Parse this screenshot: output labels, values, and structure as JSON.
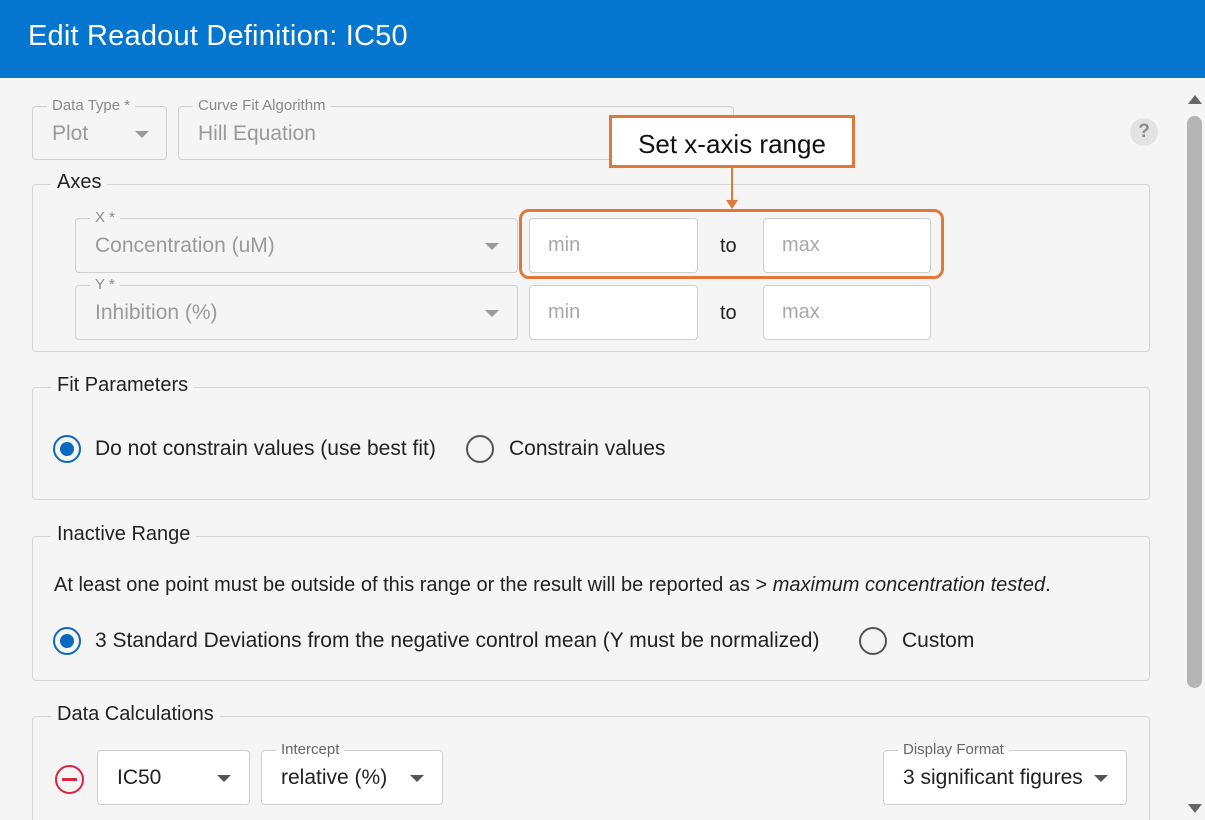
{
  "header": {
    "title": "Edit Readout Definition: IC50"
  },
  "top_fields": {
    "data_type": {
      "label": "Data Type *",
      "value": "Plot"
    },
    "curve_fit": {
      "label": "Curve Fit Algorithm",
      "value": "Hill Equation"
    }
  },
  "help_icon": {
    "glyph": "?"
  },
  "axes": {
    "legend": "Axes",
    "x": {
      "label": "X *",
      "value": "Concentration (uM)",
      "min_placeholder": "min",
      "max_placeholder": "max",
      "to": "to"
    },
    "y": {
      "label": "Y *",
      "value": "Inhibition (%)",
      "min_placeholder": "min",
      "max_placeholder": "max",
      "to": "to"
    }
  },
  "fit_parameters": {
    "legend": "Fit Parameters",
    "options": [
      {
        "label": "Do not constrain values (use best fit)",
        "checked": true
      },
      {
        "label": "Constrain values",
        "checked": false
      }
    ]
  },
  "inactive_range": {
    "legend": "Inactive Range",
    "note_prefix": "At least one point must be outside of this range or the result will be reported as > ",
    "note_emphasis": "maximum concentration tested",
    "note_suffix": ".",
    "options": [
      {
        "label": "3 Standard Deviations from the negative control mean (Y must be normalized)",
        "checked": true
      },
      {
        "label": "Custom",
        "checked": false
      }
    ]
  },
  "data_calculations": {
    "legend": "Data Calculations",
    "calc": {
      "value": "IC50"
    },
    "intercept": {
      "label": "Intercept",
      "value": "relative (%)"
    },
    "display_format": {
      "label": "Display Format",
      "value": "3 significant figures"
    }
  },
  "annotation": {
    "text": "Set x-axis range"
  },
  "colors": {
    "header": "#0476cf",
    "accent": "#0a68c0",
    "annotation": "#e0783a",
    "remove": "#d7263d"
  }
}
